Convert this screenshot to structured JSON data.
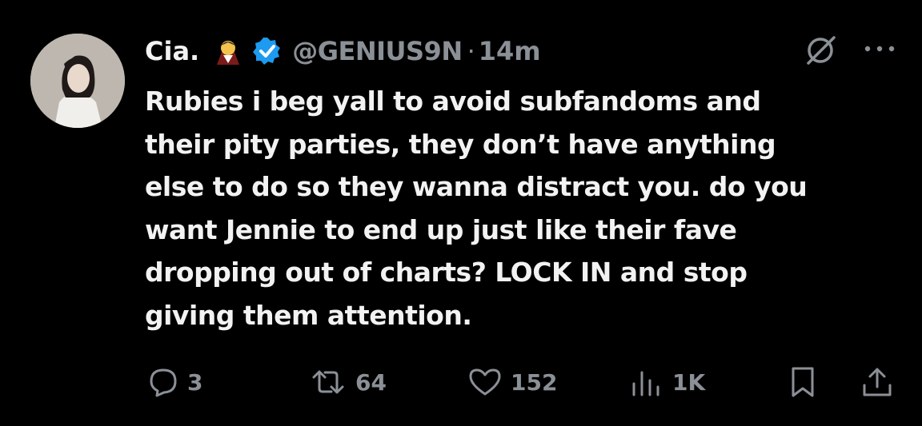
{
  "author": {
    "name": "Cia.",
    "handle": "@GENIUS9N",
    "separator": "·",
    "time": "14m"
  },
  "tweet": {
    "text": "Rubies i beg yall to avoid subfandoms and\ntheir pity parties, they don’t have anything\nelse to do so they wanna distract you. do you\nwant Jennie to end up just like their fave\ndropping out of charts? LOCK IN and stop\ngiving them attention."
  },
  "actions": {
    "replies": "3",
    "reposts": "64",
    "likes": "152",
    "views": "1K"
  },
  "colors": {
    "background": "#000000",
    "text": "#f2f2f2",
    "muted": "#8b9096",
    "verified": "#1d9bf0"
  }
}
